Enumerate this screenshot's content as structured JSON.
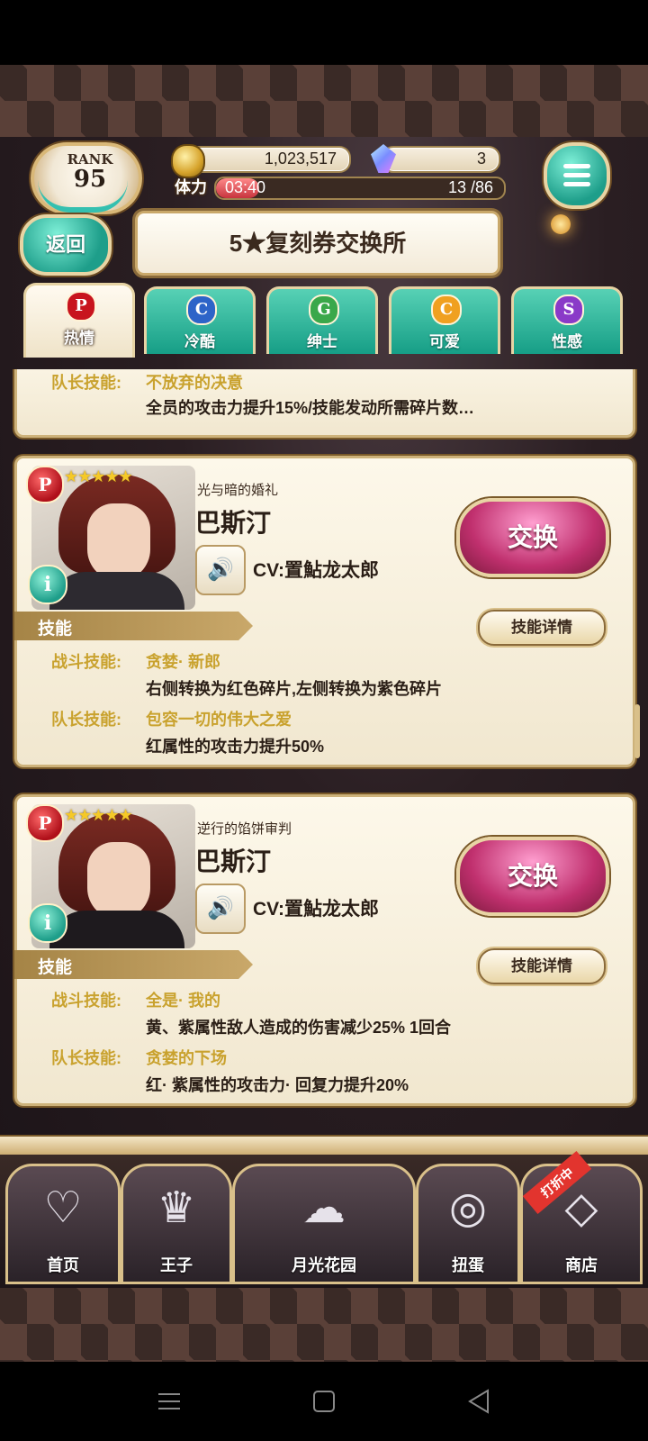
{
  "header": {
    "rank_label": "RANK",
    "rank_value": "95",
    "coins": "1,023,517",
    "gems": "3",
    "stamina_label": "体力",
    "stamina_timer": "03:40",
    "stamina_count": "13 /86",
    "stamina_fraction": 0.151,
    "back_label": "返回",
    "page_title": "5★复刻券交换所"
  },
  "tabs": [
    {
      "label": "热情",
      "icon_letter": "P",
      "icon_color": "#c8141e",
      "active": true
    },
    {
      "label": "冷酷",
      "icon_letter": "C",
      "icon_color": "#2d64c8",
      "active": false
    },
    {
      "label": "绅士",
      "icon_letter": "G",
      "icon_color": "#3aa84a",
      "active": false
    },
    {
      "label": "可爱",
      "icon_letter": "C",
      "icon_color": "#f0a020",
      "active": false
    },
    {
      "label": "性感",
      "icon_letter": "S",
      "icon_color": "#8a3ac8",
      "active": false
    }
  ],
  "partial_card": {
    "leader_label": "队长技能:",
    "leader_name": "不放弃的决意",
    "leader_desc": "全员的攻击力提升15%/技能发动所需碎片数…"
  },
  "cards": [
    {
      "rarity_letter": "P",
      "stars": "★★★★★",
      "subtitle": "光与暗的婚礼",
      "name": "巴斯汀",
      "cv": "CV:置鮎龙太郎",
      "exchange_label": "交换",
      "skill_section_label": "技能",
      "skill_detail_label": "技能详情",
      "battle_label": "战斗技能:",
      "battle_name": "贪婪· 新郎",
      "battle_desc": "右侧转换为红色碎片,左侧转换为紫色碎片",
      "leader_label": "队长技能:",
      "leader_name": "包容一切的伟大之爱",
      "leader_desc": "红属性的攻击力提升50%"
    },
    {
      "rarity_letter": "P",
      "stars": "★★★★★",
      "subtitle": "逆行的馅饼审判",
      "name": "巴斯汀",
      "cv": "CV:置鮎龙太郎",
      "exchange_label": "交换",
      "skill_section_label": "技能",
      "skill_detail_label": "技能详情",
      "battle_label": "战斗技能:",
      "battle_name": "全是· 我的",
      "battle_desc": "黄、紫属性敌人造成的伤害减少25% 1回合",
      "leader_label": "队长技能:",
      "leader_name": "贪婪的下场",
      "leader_desc": "红· 紫属性的攻击力· 回复力提升20%"
    }
  ],
  "bottom_nav": [
    {
      "label": "首页",
      "icon": "heart-ornament-icon"
    },
    {
      "label": "王子",
      "icon": "crown-icon"
    },
    {
      "label": "月光花园",
      "icon": "pets-silhouette-icon"
    },
    {
      "label": "扭蛋",
      "icon": "gacha-ring-icon"
    },
    {
      "label": "商店",
      "icon": "gem-box-icon"
    }
  ],
  "sale_badge": "打折中",
  "colors": {
    "accent_teal": "#1e9e8a",
    "exchange_pink": "#c0306e",
    "skill_gold": "#c9a22e"
  }
}
